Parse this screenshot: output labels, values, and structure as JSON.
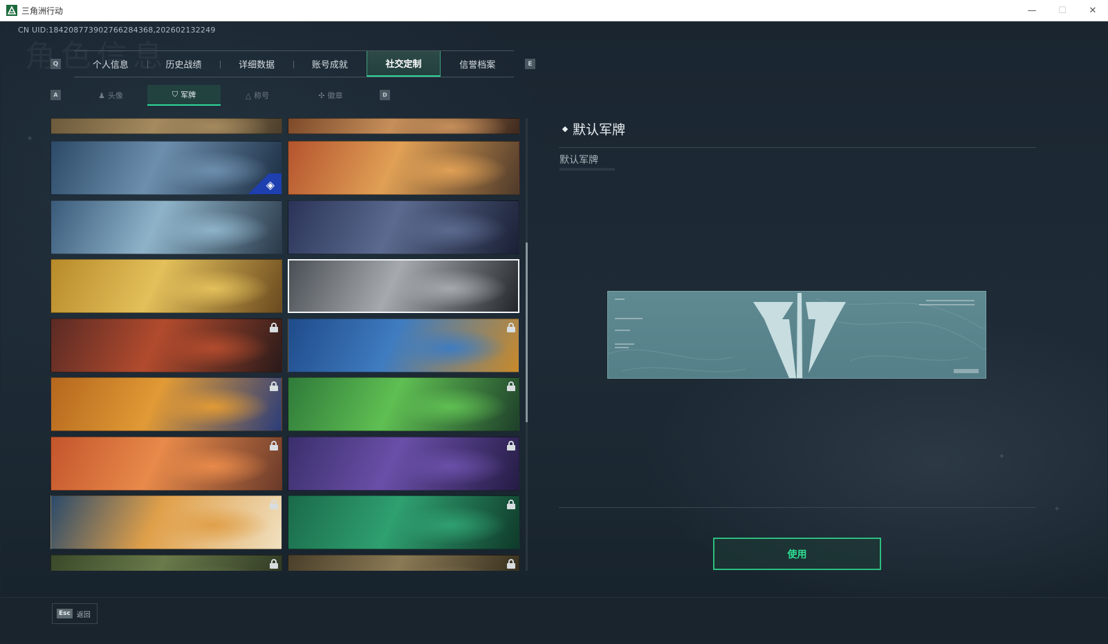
{
  "window": {
    "title": "三角洲行动",
    "minimize_glyph": "—",
    "maximize_glyph": "☐",
    "close_glyph": "✕"
  },
  "uid_text": "CN UID:18420877390276628436​8,202602132249",
  "bg_heading": "角色信息",
  "main_tabs": {
    "left_key": "Q",
    "right_key": "E",
    "items": [
      {
        "label": "个人信息"
      },
      {
        "label": "历史战绩"
      },
      {
        "label": "详细数据"
      },
      {
        "label": "账号成就"
      },
      {
        "label": "社交定制",
        "active": true
      },
      {
        "label": "信誉档案"
      }
    ]
  },
  "sub_tabs": {
    "left_key": "A",
    "right_key": "D",
    "items": [
      {
        "label": "头像",
        "icon": "person-icon"
      },
      {
        "label": "军牌",
        "icon": "badge-icon",
        "active": true
      },
      {
        "label": "称号",
        "icon": "title-icon"
      },
      {
        "label": "徽章",
        "icon": "emblem-icon"
      }
    ]
  },
  "cards": [
    {
      "id": "c0a",
      "locked": false,
      "colors": [
        "#6b5a3c",
        "#a58a5e",
        "#4c3f2c"
      ]
    },
    {
      "id": "c0b",
      "locked": false,
      "colors": [
        "#7d4a2a",
        "#c68f5a",
        "#3f2a1f"
      ]
    },
    {
      "id": "c1a",
      "locked": false,
      "colors": [
        "#2c4a68",
        "#6d8fae",
        "#1b2d42"
      ],
      "brand": true
    },
    {
      "id": "c1b",
      "locked": false,
      "colors": [
        "#b5542e",
        "#e0a055",
        "#4e3a2a"
      ]
    },
    {
      "id": "c2a",
      "locked": false,
      "colors": [
        "#3a5a7a",
        "#8eb3c9",
        "#2a3a4a"
      ]
    },
    {
      "id": "c2b",
      "locked": false,
      "colors": [
        "#2a3458",
        "#5b6a8f",
        "#1a2035"
      ]
    },
    {
      "id": "c3a",
      "locked": false,
      "colors": [
        "#b88a2a",
        "#e3c05a",
        "#6b4a1f"
      ]
    },
    {
      "id": "c3b",
      "locked": false,
      "colors": [
        "#4a4f55",
        "#a6aaae",
        "#23262a"
      ],
      "selected": true
    },
    {
      "id": "c4a",
      "locked": true,
      "colors": [
        "#5a2a24",
        "#b24b2d",
        "#2a1a1a"
      ]
    },
    {
      "id": "c4b",
      "locked": true,
      "colors": [
        "#1f4b8a",
        "#3f7cc0",
        "#c98a2a"
      ]
    },
    {
      "id": "c5a",
      "locked": true,
      "colors": [
        "#b5671d",
        "#e19a35",
        "#2b3d7a"
      ]
    },
    {
      "id": "c5b",
      "locked": true,
      "colors": [
        "#2f7a3a",
        "#5fbf52",
        "#1e3f2a"
      ]
    },
    {
      "id": "c6a",
      "locked": true,
      "colors": [
        "#c4552c",
        "#e88a4a",
        "#6a3a2a"
      ]
    },
    {
      "id": "c6b",
      "locked": true,
      "colors": [
        "#3a2f6b",
        "#6a4fa8",
        "#251c45"
      ]
    },
    {
      "id": "c7a",
      "locked": true,
      "colors": [
        "#2a4a6a",
        "#e0a04a",
        "#f0e0c0"
      ]
    },
    {
      "id": "c7b",
      "locked": true,
      "colors": [
        "#1a6a4a",
        "#2fa070",
        "#0f3a2a"
      ]
    },
    {
      "id": "c8a",
      "locked": true,
      "colors": [
        "#3a4a2a",
        "#6a7a4a",
        "#2a3320"
      ]
    },
    {
      "id": "c8b",
      "locked": true,
      "colors": [
        "#4a3f2a",
        "#8a7a55",
        "#2e2718"
      ]
    }
  ],
  "detail": {
    "title": "默认军牌",
    "subtitle": "默认军牌",
    "use_button": "使用"
  },
  "footer": {
    "esc_key": "Esc",
    "esc_label": "返回"
  },
  "colors": {
    "accent": "#2ed89a",
    "preview_bg": "#5f8a92",
    "preview_logo": "#c7dde0"
  }
}
